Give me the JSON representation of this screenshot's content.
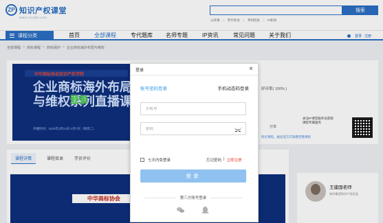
{
  "header": {
    "logo_mark": "ZP",
    "logo_text": "知识产权课堂",
    "logo_url": "www.zscqkt.com",
    "search_placeholder": "",
    "search_button": "搜索",
    "quick_links": [
      "公开课",
      "专代考试",
      "专利检索",
      "IP职场"
    ]
  },
  "nav": {
    "category_button": "课程分类",
    "items": [
      "首页",
      "全部课程",
      "专代题库",
      "名师专题",
      "IP资讯",
      "常见问题",
      "关于我们"
    ],
    "active_index": 1,
    "login": "登录",
    "register": "注册"
  },
  "breadcrumb": [
    "全部课程",
    "商标课程",
    "商标保护",
    "企业商标海外布局与维权"
  ],
  "course": {
    "banner_top": "中华商标协会知识产权学院",
    "banner_title_lines": [
      "企业商标海外布局",
      "与维权系列直播课"
    ],
    "banner_date": "开播时间：2020年3月24日-4月7日（每周二）",
    "rating": "好评率( 100% )",
    "share": "分享",
    "qr_text": "关注IP课堂服务号获取课程专属服务",
    "tip": "购买课程，报名后方可观看完整课程"
  },
  "tabs": [
    "课程详情",
    "课程目录",
    "学员评价"
  ],
  "content_banner_title": "中华商标协会",
  "teacher": {
    "name": "王建国老师",
    "org": "海尔集团知识产权总监"
  },
  "modal": {
    "title": "登录",
    "tab_account": "账号密码登录",
    "tab_sms": "手机动态码登录",
    "phone_placeholder": "手机号",
    "password_placeholder": "密码",
    "remember": "七天内免登录",
    "forgot": "忘记密码",
    "divider": "|",
    "register": "立即注册",
    "login_button": "登录",
    "third_party": "第三方账号登录"
  },
  "watermark": "登录"
}
